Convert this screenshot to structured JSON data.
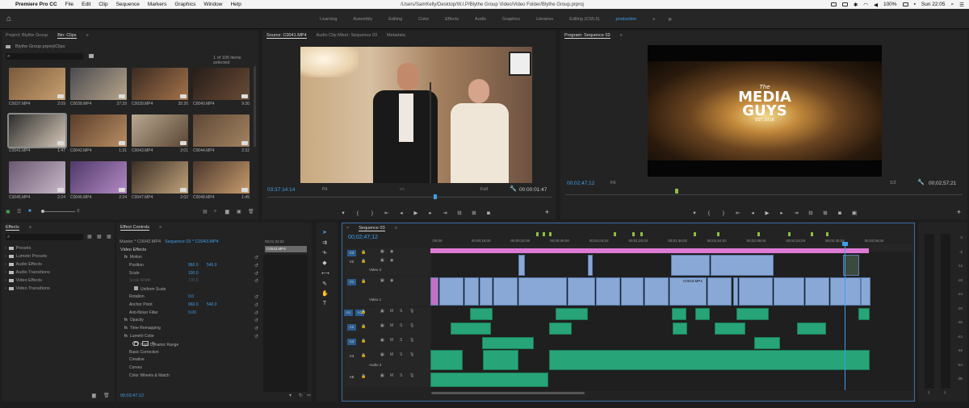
{
  "menubar": {
    "app_name": "Premiere Pro CC",
    "menus": [
      "File",
      "Edit",
      "Clip",
      "Sequence",
      "Markers",
      "Graphics",
      "Window",
      "Help"
    ],
    "path": "/Users/SamKelly/Desktop/W.I.P/Blythe Group Video/Video Folder/Blythe Group.prproj",
    "battery": "100%",
    "clock": "Sun 22:05"
  },
  "workspaces": {
    "tabs": [
      "Learning",
      "Assembly",
      "Editing",
      "Color",
      "Effects",
      "Audio",
      "Graphics",
      "Libraries",
      "Editing (CS5.5)",
      "production"
    ],
    "active": "production",
    "more": "»"
  },
  "project": {
    "tab_project": "Project: Blythe Group",
    "tab_bin": "Bin: Clips",
    "breadcrumb": "Blythe Group.prproj\\Clips",
    "count": "1 of 105 items selected",
    "clips": [
      {
        "name": "C0037.MP4",
        "duration": "2:09"
      },
      {
        "name": "C0038.MP4",
        "duration": "27:29"
      },
      {
        "name": "C0039.MP4",
        "duration": "35:26"
      },
      {
        "name": "C0040.MP4",
        "duration": "9:30"
      },
      {
        "name": "C0041.MP4",
        "duration": "1:47"
      },
      {
        "name": "C0042.MP4",
        "duration": "1:31"
      },
      {
        "name": "C0043.MP4",
        "duration": "2:01"
      },
      {
        "name": "C0044.MP4",
        "duration": "2:32"
      },
      {
        "name": "C0045.MP4",
        "duration": "2:24"
      },
      {
        "name": "C0046.MP4",
        "duration": "2:24"
      },
      {
        "name": "C0047.MP4",
        "duration": "2:02"
      },
      {
        "name": "C0048.MP4",
        "duration": "1:45"
      }
    ]
  },
  "source": {
    "tabs": [
      "Source: C0041.MP4",
      "Audio Clip Mixer: Sequence 03",
      "Metadata"
    ],
    "timecode": "03:37:14:14",
    "fit": "Fit",
    "resolution": "Full",
    "duration": "00:00:01:47"
  },
  "program": {
    "tab": "Program: Sequence 03",
    "timecode": "00;02;47;12",
    "fit": "Fit",
    "resolution": "1/2",
    "duration": "00;02;57;21",
    "logo": {
      "top": "The",
      "line1": "MEDIA",
      "line2": "GUYS",
      "est": "EST 2016"
    }
  },
  "effects_panel": {
    "tab": "Effects",
    "folders": [
      "Presets",
      "Lumetri Presets",
      "Audio Effects",
      "Audio Transitions",
      "Video Effects",
      "Video Transitions"
    ]
  },
  "effect_controls": {
    "tab": "Effect Controls",
    "master": "Master * C0043.MP4",
    "sequence": "Sequence 03 * C0043.MP4",
    "clip_chip": "C0043.MP4",
    "time_ruler": "00;01;32;02",
    "video_effects_label": "Video Effects",
    "rows": [
      {
        "label": "Motion",
        "indent": 1,
        "fx": true
      },
      {
        "label": "Position",
        "indent": 2,
        "v1": "960.0",
        "v2": "540.0"
      },
      {
        "label": "Scale",
        "indent": 2,
        "v1": "100.0"
      },
      {
        "label": "Scale Width",
        "indent": 2,
        "v1": "100.0",
        "dim": true
      },
      {
        "label": "Uniform Scale",
        "indent": 3,
        "check": true
      },
      {
        "label": "Rotation",
        "indent": 2,
        "v1": "0.0"
      },
      {
        "label": "Anchor Point",
        "indent": 2,
        "v1": "960.0",
        "v2": "540.0"
      },
      {
        "label": "Anti-flicker Filter",
        "indent": 2,
        "v1": "0.00"
      },
      {
        "label": "Opacity",
        "indent": 1,
        "fx": true
      },
      {
        "label": "Time Remapping",
        "indent": 1,
        "fx": true
      },
      {
        "label": "Lumetri Color",
        "indent": 1,
        "fx": true
      },
      {
        "label": "High Dynamic Range",
        "indent": 3,
        "check": false
      },
      {
        "label": "Basic Correction",
        "indent": 2
      },
      {
        "label": "Creative",
        "indent": 2
      },
      {
        "label": "Curves",
        "indent": 2
      },
      {
        "label": "Color Wheels & Match",
        "indent": 2
      }
    ],
    "footer_timecode": "00;02;47;12"
  },
  "timeline": {
    "tab": "Sequence 03",
    "timecode": "00;02;47;12",
    "ruler": [
      ";00;00",
      "00;00;16;00",
      "00;00;32;00",
      "00;00;48;00",
      "00;01;04;02",
      "00;01;20;02",
      "00;01;36;02",
      "00;01;52;02",
      "00;02;08;04",
      "00;02;24;04",
      "00;02;40;04",
      "00;02;56;04"
    ],
    "tracks": [
      {
        "id": "V3",
        "name": "",
        "kind": "video",
        "target": true
      },
      {
        "id": "V2",
        "name": "Video 2",
        "kind": "video"
      },
      {
        "id": "V1",
        "name": "Video 1",
        "kind": "video",
        "target": true
      },
      {
        "id": "A1",
        "name": "",
        "kind": "audio",
        "src": "A1",
        "target": true
      },
      {
        "id": "A2",
        "name": "",
        "kind": "audio",
        "target": true
      },
      {
        "id": "A3",
        "name": "",
        "kind": "audio",
        "target": true
      },
      {
        "id": "A4",
        "name": "Audio 4",
        "kind": "audio"
      },
      {
        "id": "A5",
        "name": "",
        "kind": "audio"
      }
    ],
    "clip_label": "C0043.MP4"
  },
  "meters": {
    "scale": [
      "0",
      "-6",
      "-12",
      "-18",
      "-24",
      "-30",
      "-36",
      "-42",
      "-48",
      "-54",
      "dB"
    ],
    "channels": [
      "1",
      "1"
    ]
  },
  "colors": {
    "accent": "#3f9ee8",
    "video_clip": "#89a8d6",
    "audio_clip": "#27a578",
    "pink_clip": "#dd7ad4"
  }
}
